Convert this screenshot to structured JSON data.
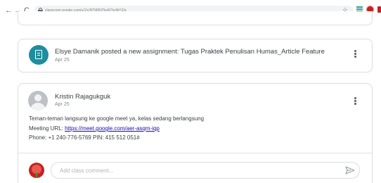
{
  "browser": {
    "back": "←",
    "forward": "→",
    "reload": "C",
    "url": "classroom.google.com/u/1/c/NTM0NTkxNTkyNjY2/a",
    "star": "☆"
  },
  "stream": {
    "assignment": {
      "icon": "assignment-icon",
      "title": "Elsye Damanik posted a new assignment: Tugas Praktek Penulisan Humas_Article Feature",
      "date": "Apr 25"
    },
    "post": {
      "author": "Kristin Rajagukguk",
      "date": "Apr 25",
      "text": "Teman-teman langsung ke google meet ya, kelas sedang berlangsung",
      "meeting_label": "Meeting URL: ",
      "meeting_url": "https://meet.google.com/aer-asqm-iqp",
      "phone": "Phone: +1 240-776-5769 PIN: 415 512 051#"
    },
    "comment": {
      "placeholder": "Add class comment..."
    }
  },
  "colors": {
    "assignment_icon_bg": "#1e8e9e",
    "link": "#1a0dab",
    "user_avatar": "#c5221f"
  }
}
